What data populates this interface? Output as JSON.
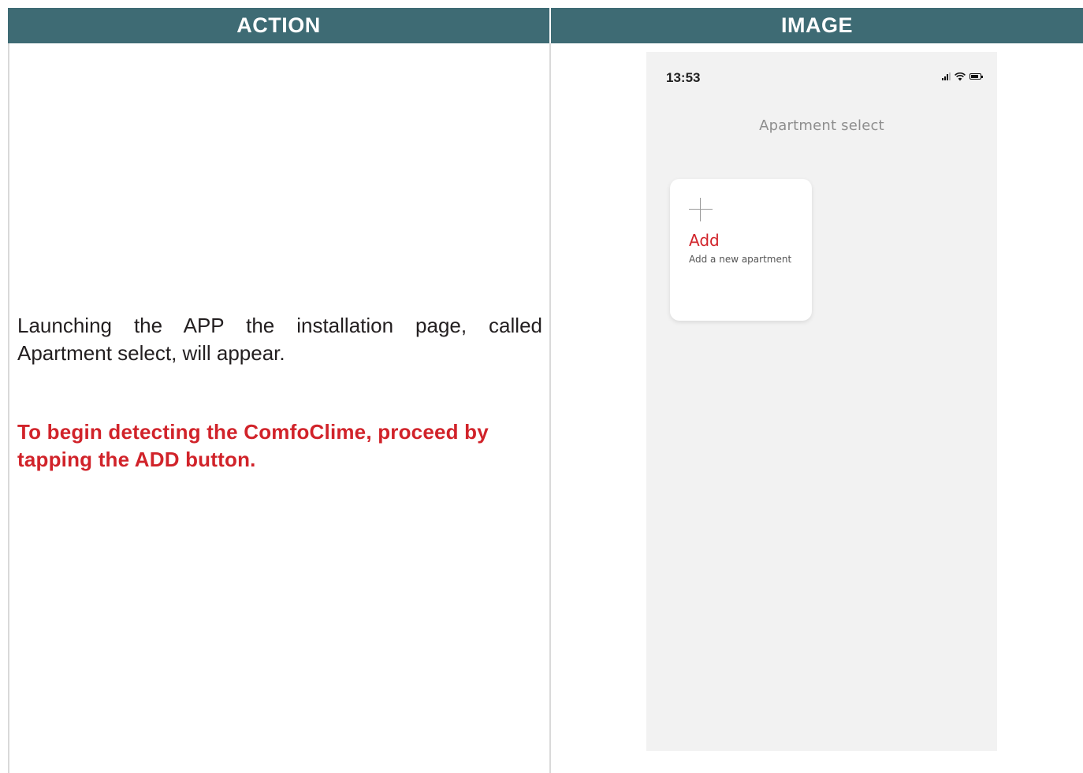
{
  "table": {
    "header_action": "ACTION",
    "header_image": "IMAGE"
  },
  "action": {
    "description": "Launching the APP the installation page, called Apartment select, will appear.",
    "highlight": "To begin detecting the ComfoClime, proceed by tapping the ADD button."
  },
  "phone": {
    "status": {
      "time": "13:53",
      "icons": [
        "signal-icon",
        "wifi-icon",
        "battery-icon"
      ]
    },
    "title": "Apartment select",
    "add_card": {
      "icon": "plus-icon",
      "label": "Add",
      "subtitle": "Add a new apartment"
    }
  },
  "colors": {
    "header_bg": "#3e6b74",
    "accent_red": "#d1232a",
    "phone_bg": "#f2f2f2"
  }
}
